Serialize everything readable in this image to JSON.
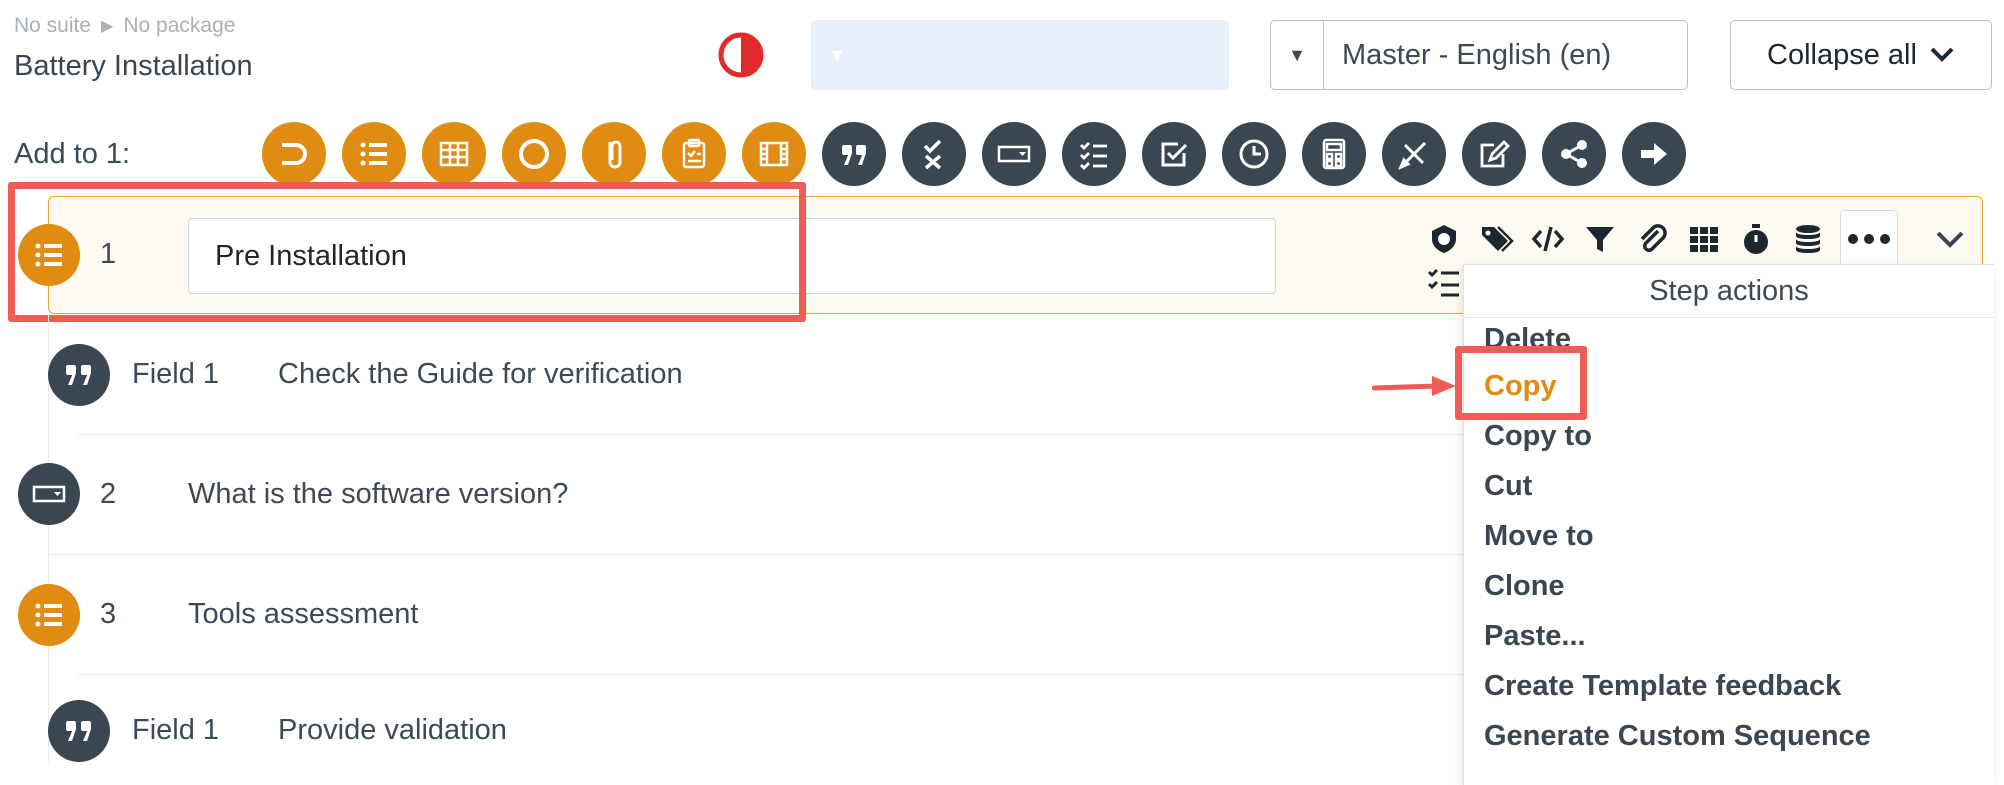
{
  "breadcrumb": {
    "suite": "No suite",
    "package": "No package"
  },
  "document": {
    "title": "Battery Installation"
  },
  "language_select": {
    "value": "Master - English (en)"
  },
  "collapse_button": {
    "label": "Collapse all"
  },
  "toolbar": {
    "add_label": "Add to 1:",
    "buttons": [
      {
        "name": "partial-circle-icon",
        "color": "#e08b12"
      },
      {
        "name": "numbered-list-icon",
        "color": "#e08b12"
      },
      {
        "name": "table-icon",
        "color": "#e08b12"
      },
      {
        "name": "circle-icon",
        "color": "#e08b12"
      },
      {
        "name": "loop-icon",
        "color": "#e08b12"
      },
      {
        "name": "clipboard-icon",
        "color": "#e08b12"
      },
      {
        "name": "film-icon",
        "color": "#e08b12"
      },
      {
        "name": "quote-icon",
        "color": "#3a4651"
      },
      {
        "name": "check-cross-icon",
        "color": "#3a4651"
      },
      {
        "name": "dropdown-field-icon",
        "color": "#3a4651"
      },
      {
        "name": "checklist-icon",
        "color": "#3a4651"
      },
      {
        "name": "checkbox-icon",
        "color": "#3a4651"
      },
      {
        "name": "clock-icon",
        "color": "#3a4651"
      },
      {
        "name": "calculator-icon",
        "color": "#3a4651"
      },
      {
        "name": "ruler-pencil-icon",
        "color": "#3a4651"
      },
      {
        "name": "signature-icon",
        "color": "#3a4651"
      },
      {
        "name": "share-icon",
        "color": "#3a4651"
      },
      {
        "name": "arrow-right-icon",
        "color": "#3a4651"
      }
    ]
  },
  "steps": [
    {
      "number": "1",
      "title": "Pre Installation",
      "type": "numbered-list-icon"
    },
    {
      "label": "Field 1",
      "text": "Check the Guide for verification",
      "type": "quote-icon"
    },
    {
      "number": "2",
      "text": "What is the software version?",
      "type": "dropdown-field-icon"
    },
    {
      "number": "3",
      "text": "Tools assessment",
      "type": "numbered-list-icon"
    },
    {
      "label": "Field 1",
      "text": "Provide validation",
      "type": "quote-icon"
    }
  ],
  "step_actions": {
    "header": "Step actions",
    "items": [
      "Delete",
      "Copy",
      "Copy to",
      "Cut",
      "Move to",
      "Clone",
      "Paste...",
      "Create Template feedback",
      "Generate Custom Sequence"
    ],
    "highlighted": "Copy"
  },
  "colors": {
    "accent_orange": "#e08b12",
    "dark_icon": "#3a4651",
    "annotation_red": "#ef5b55"
  }
}
